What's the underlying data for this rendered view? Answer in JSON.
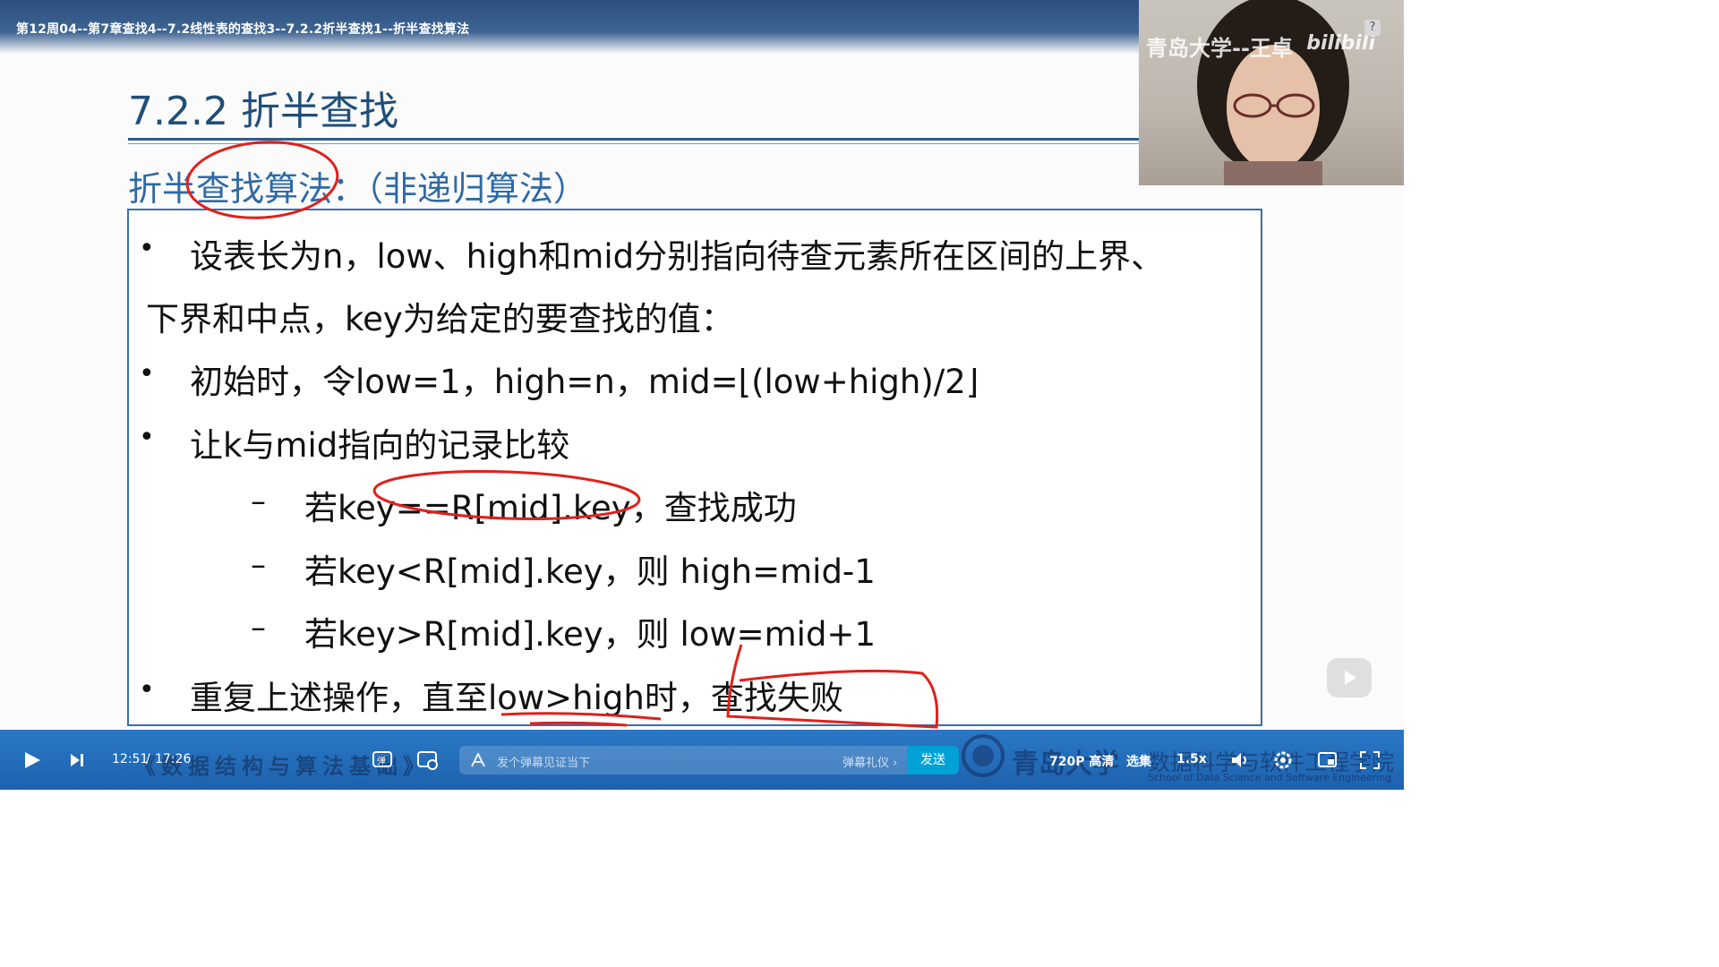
{
  "video": {
    "title": "第12周04--第7章查找4--7.2线性表的查找3--7.2.2折半查找1--折半查找算法"
  },
  "slide": {
    "heading": "7.2.2 折半查找",
    "subheading": "折半查找算法：（非递归算法）",
    "lines": [
      {
        "bullet": "•",
        "text": "设表长为n，low、high和mid分别指向待查元素所在区间的上界、"
      },
      {
        "bullet": "",
        "text": "下界和中点，key为给定的要查找的值："
      },
      {
        "bullet": "•",
        "text": "初始时，令low=1，high=n，mid=⌊(low+high)/2⌋"
      },
      {
        "bullet": "•",
        "text": "让k与mid指向的记录比较"
      },
      {
        "bullet": "–",
        "text": "若key==R[mid].key，查找成功"
      },
      {
        "bullet": "–",
        "text": "若key<R[mid].key，则 high=mid-1"
      },
      {
        "bullet": "–",
        "text": "若key>R[mid].key，则 low=mid+1"
      },
      {
        "bullet": "•",
        "text": "重复上述操作，直至low>high时，查找失败"
      }
    ],
    "annotation_color": "#e0201c"
  },
  "webcam": {
    "watermark": "青岛大学--王卓",
    "logo": "bilibili",
    "help": "?"
  },
  "player": {
    "time_current": "12:51",
    "time_separator": "/",
    "time_total": "17:26",
    "book_title": "《数据结构与算法基础》",
    "danmaku_placeholder": "发个弹幕见证当下",
    "danmaku_etiquette": "弹幕礼仪 ›",
    "send_label": "发送",
    "quality": "720P 高清",
    "episodes": "选集",
    "speed": "1.5x",
    "school_cn": "青岛大学",
    "school_dept": "数据科学与软件工程学院",
    "school_en": "School of Data Science and Software Engineering",
    "accent": "#00a1d6"
  }
}
